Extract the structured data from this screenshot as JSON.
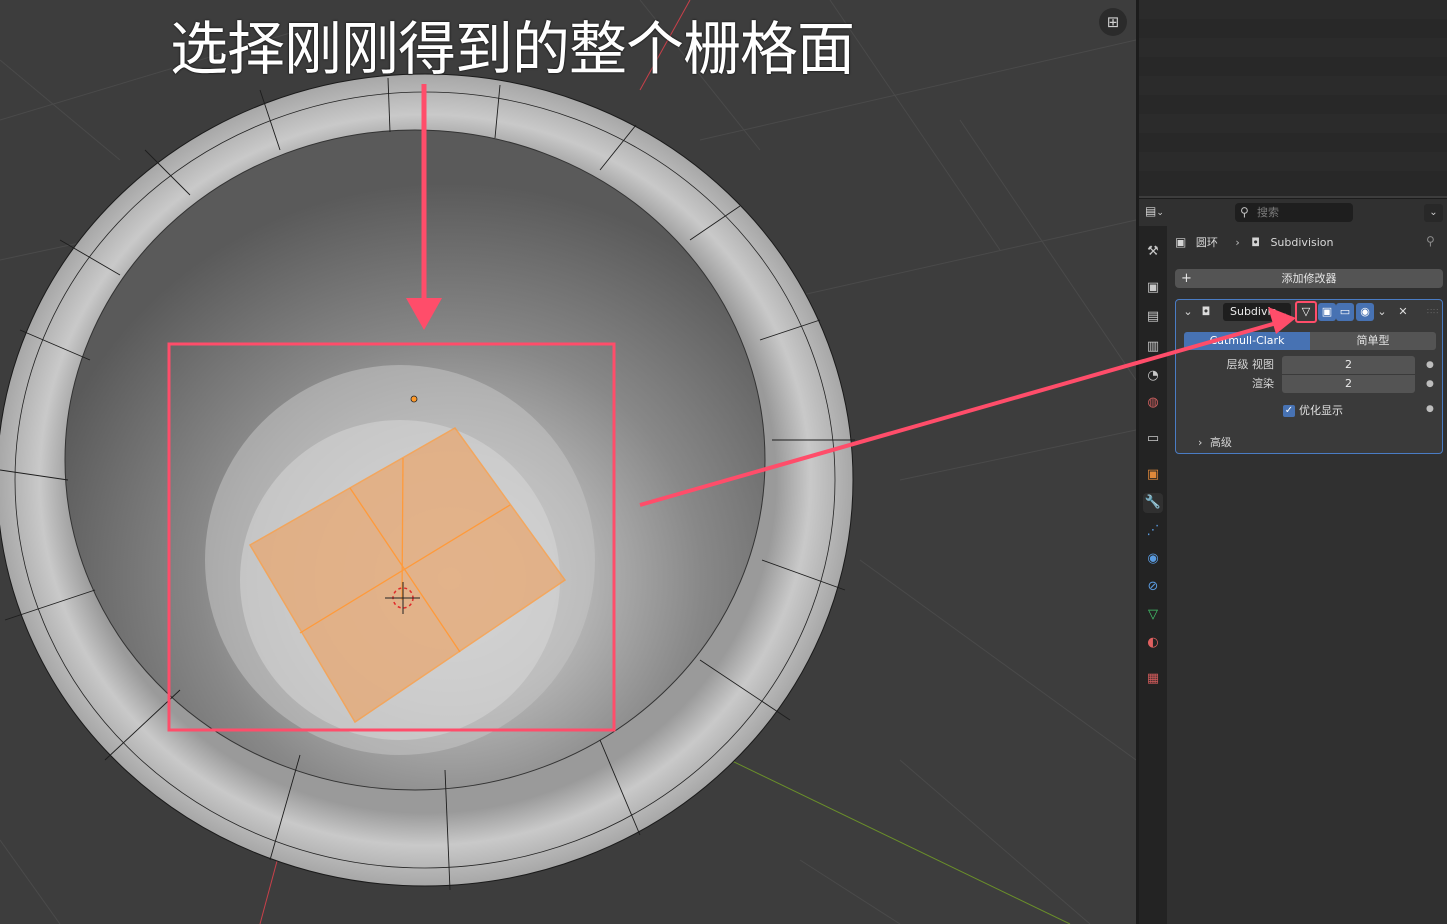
{
  "annotation": {
    "title": "选择刚刚得到的整个栅格面",
    "accent_color": "#ff4d6a"
  },
  "viewport": {
    "gizmo_icon": "grid-perspective-icon",
    "selection_color": "#ffa64d",
    "background_color": "#3d3d3d"
  },
  "properties": {
    "editor_type_icon": "properties-editor-icon",
    "search_placeholder": "搜索",
    "dropdown_glyph": "⌄",
    "breadcrumb": {
      "object_name": "圆环",
      "separator": "›",
      "modifier_name": "Subdivision"
    },
    "add_modifier_label": "添加修改器",
    "tabs": [
      {
        "name": "tool-tab",
        "icon": "⚒",
        "color": "#c8c8c8"
      },
      {
        "name": "render-tab",
        "icon": "▣",
        "color": "#c8c8c8"
      },
      {
        "name": "output-tab",
        "icon": "▤",
        "color": "#c8c8c8"
      },
      {
        "name": "view-layer-tab",
        "icon": "▥",
        "color": "#c8c8c8"
      },
      {
        "name": "scene-tab",
        "icon": "◔",
        "color": "#c8c8c8"
      },
      {
        "name": "world-tab",
        "icon": "◍",
        "color": "#d06060"
      },
      {
        "name": "collection-tab",
        "icon": "▭",
        "color": "#c8c8c8"
      },
      {
        "name": "object-tab",
        "icon": "▣",
        "color": "#e0883a"
      },
      {
        "name": "modifier-tab",
        "icon": "🔧",
        "color": "#5a9be0"
      },
      {
        "name": "particles-tab",
        "icon": "⋰",
        "color": "#5a9be0"
      },
      {
        "name": "physics-tab",
        "icon": "◉",
        "color": "#5a9be0"
      },
      {
        "name": "constraints-tab",
        "icon": "⊘",
        "color": "#5a9be0"
      },
      {
        "name": "data-tab",
        "icon": "▽",
        "color": "#43c86b"
      },
      {
        "name": "material-tab",
        "icon": "◐",
        "color": "#e06060"
      },
      {
        "name": "texture-tab",
        "icon": "▦",
        "color": "#d05a5a"
      }
    ],
    "modifier": {
      "name": "Subdivis...",
      "mode_catmull": "Catmull-Clark",
      "mode_simple": "简单型",
      "levels_viewport_label": "层级 视图",
      "levels_viewport_value": "2",
      "render_label": "渲染",
      "render_value": "2",
      "optimal_display_label": "优化显示",
      "optimal_display_checked": true,
      "advanced_label": "高级",
      "close_glyph": "✕"
    }
  }
}
